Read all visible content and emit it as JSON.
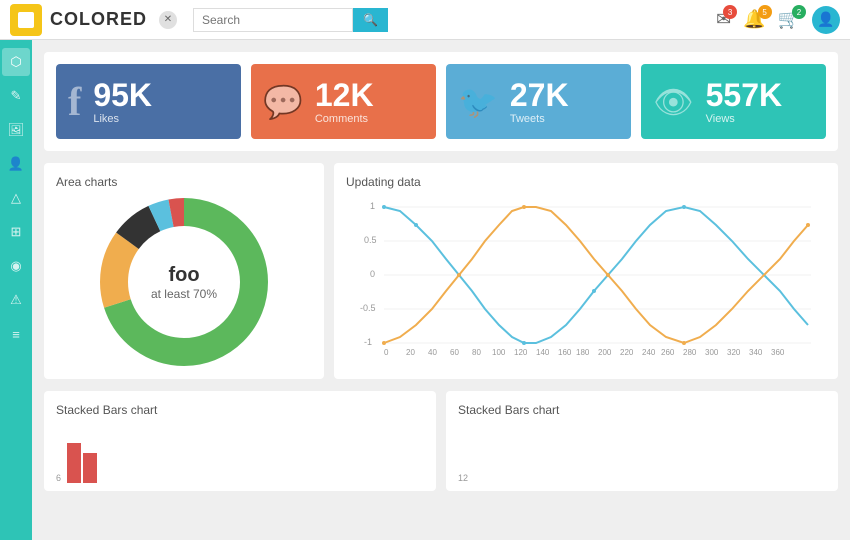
{
  "app": {
    "title": "COLORED",
    "search_placeholder": "Search"
  },
  "nav_right": {
    "mail_badge": "3",
    "bell_badge": "5",
    "cart_badge": "2"
  },
  "stats": [
    {
      "id": "facebook",
      "value": "95K",
      "label": "Likes",
      "icon": "f",
      "color": "blue"
    },
    {
      "id": "comments",
      "value": "12K",
      "label": "Comments",
      "icon": "💬",
      "color": "orange"
    },
    {
      "id": "twitter",
      "value": "27K",
      "label": "Tweets",
      "icon": "🐦",
      "color": "light-blue"
    },
    {
      "id": "views",
      "value": "557K",
      "label": "Views",
      "icon": "👁",
      "color": "teal"
    }
  ],
  "area_chart": {
    "title": "Area charts",
    "center_title": "foo",
    "center_sub": "at least 70%",
    "segments": [
      {
        "color": "#5cb85c",
        "pct": 70,
        "label": "Green"
      },
      {
        "color": "#f0ad4e",
        "pct": 15,
        "label": "Orange"
      },
      {
        "color": "#333",
        "pct": 8,
        "label": "Black"
      },
      {
        "color": "#5bc0de",
        "pct": 4,
        "label": "Cyan"
      },
      {
        "color": "#d9534f",
        "pct": 3,
        "label": "Red"
      }
    ]
  },
  "line_chart": {
    "title": "Updating data",
    "x_labels": [
      "0",
      "20",
      "40",
      "60",
      "80",
      "100",
      "120",
      "140",
      "160",
      "180",
      "200",
      "220",
      "240",
      "260",
      "280",
      "300",
      "320",
      "340",
      "360"
    ],
    "y_labels": [
      "1",
      "0.5",
      "0",
      "-0.5",
      "-1"
    ]
  },
  "bottom_charts": [
    {
      "title": "Stacked Bars chart",
      "y_label": "6"
    },
    {
      "title": "Stacked Bars chart",
      "y_label": "12"
    }
  ],
  "sidebar_icons": [
    "share",
    "edit",
    "image",
    "user",
    "pin",
    "grid",
    "map",
    "warning",
    "list"
  ]
}
